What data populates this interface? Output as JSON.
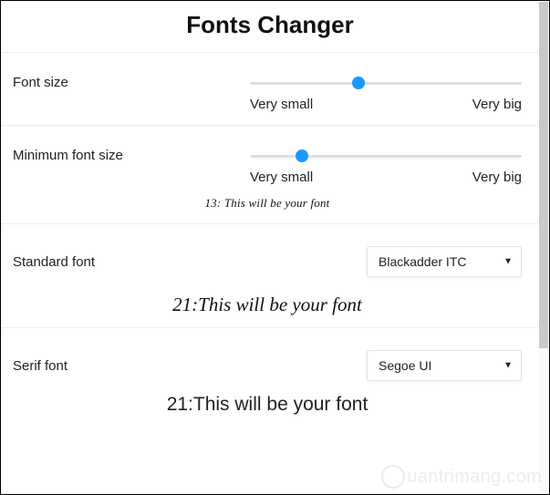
{
  "title": "Fonts Changer",
  "sliders": {
    "font_size": {
      "label": "Font size",
      "min_label": "Very small",
      "max_label": "Very big",
      "position_pct": 40
    },
    "min_font_size": {
      "label": "Minimum font size",
      "min_label": "Very small",
      "max_label": "Very big",
      "position_pct": 19,
      "preview": "13: This will be your font"
    }
  },
  "fonts": {
    "standard": {
      "label": "Standard font",
      "value": "Blackadder ITC",
      "preview": "21:This will be your font"
    },
    "serif": {
      "label": "Serif font",
      "value": "Segoe UI",
      "preview": "21:This will be your font"
    }
  },
  "watermark": "uantrimang.com"
}
